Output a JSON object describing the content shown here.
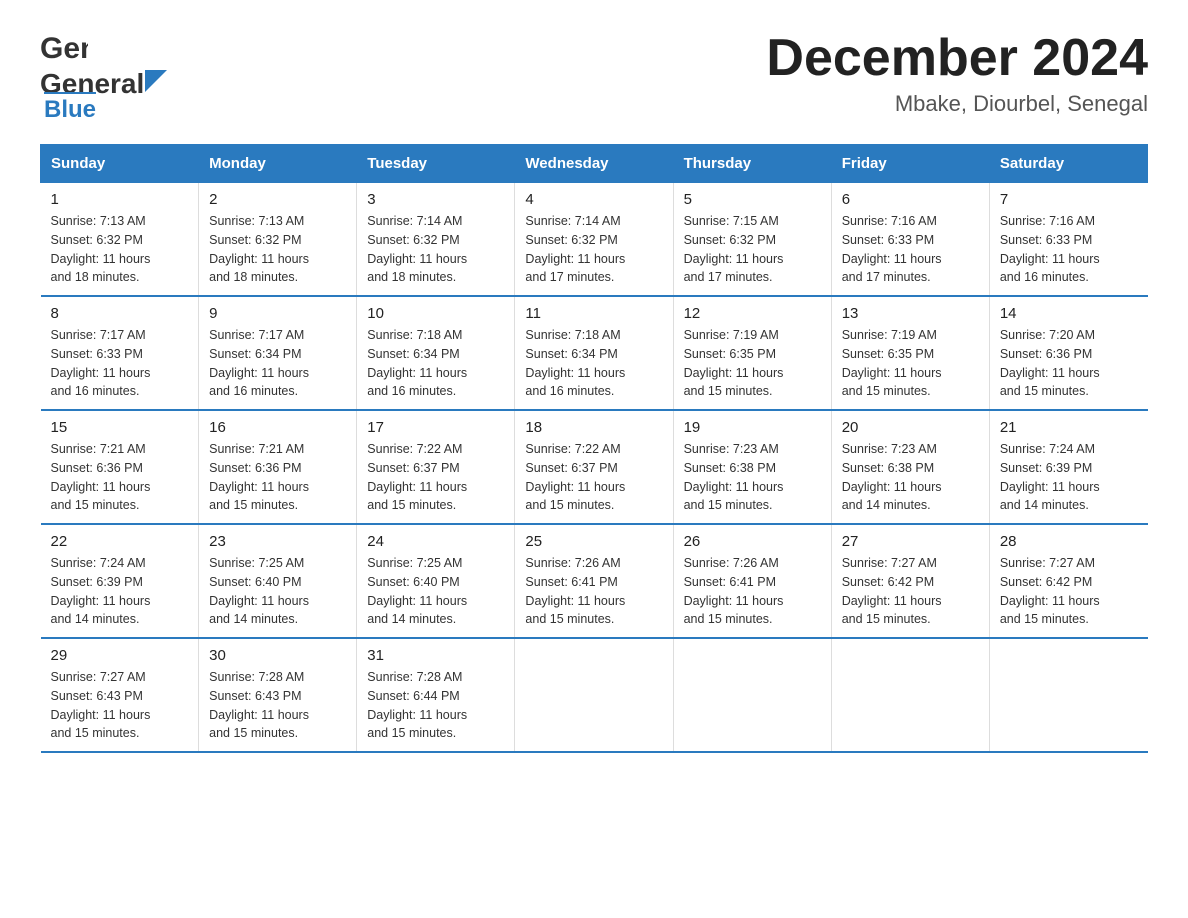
{
  "logo": {
    "general": "General",
    "blue": "Blue"
  },
  "title": {
    "month": "December 2024",
    "location": "Mbake, Diourbel, Senegal"
  },
  "days_of_week": [
    "Sunday",
    "Monday",
    "Tuesday",
    "Wednesday",
    "Thursday",
    "Friday",
    "Saturday"
  ],
  "weeks": [
    [
      {
        "day": 1,
        "sunrise": "7:13 AM",
        "sunset": "6:32 PM",
        "daylight": "11 hours and 18 minutes."
      },
      {
        "day": 2,
        "sunrise": "7:13 AM",
        "sunset": "6:32 PM",
        "daylight": "11 hours and 18 minutes."
      },
      {
        "day": 3,
        "sunrise": "7:14 AM",
        "sunset": "6:32 PM",
        "daylight": "11 hours and 18 minutes."
      },
      {
        "day": 4,
        "sunrise": "7:14 AM",
        "sunset": "6:32 PM",
        "daylight": "11 hours and 17 minutes."
      },
      {
        "day": 5,
        "sunrise": "7:15 AM",
        "sunset": "6:32 PM",
        "daylight": "11 hours and 17 minutes."
      },
      {
        "day": 6,
        "sunrise": "7:16 AM",
        "sunset": "6:33 PM",
        "daylight": "11 hours and 17 minutes."
      },
      {
        "day": 7,
        "sunrise": "7:16 AM",
        "sunset": "6:33 PM",
        "daylight": "11 hours and 16 minutes."
      }
    ],
    [
      {
        "day": 8,
        "sunrise": "7:17 AM",
        "sunset": "6:33 PM",
        "daylight": "11 hours and 16 minutes."
      },
      {
        "day": 9,
        "sunrise": "7:17 AM",
        "sunset": "6:34 PM",
        "daylight": "11 hours and 16 minutes."
      },
      {
        "day": 10,
        "sunrise": "7:18 AM",
        "sunset": "6:34 PM",
        "daylight": "11 hours and 16 minutes."
      },
      {
        "day": 11,
        "sunrise": "7:18 AM",
        "sunset": "6:34 PM",
        "daylight": "11 hours and 16 minutes."
      },
      {
        "day": 12,
        "sunrise": "7:19 AM",
        "sunset": "6:35 PM",
        "daylight": "11 hours and 15 minutes."
      },
      {
        "day": 13,
        "sunrise": "7:19 AM",
        "sunset": "6:35 PM",
        "daylight": "11 hours and 15 minutes."
      },
      {
        "day": 14,
        "sunrise": "7:20 AM",
        "sunset": "6:36 PM",
        "daylight": "11 hours and 15 minutes."
      }
    ],
    [
      {
        "day": 15,
        "sunrise": "7:21 AM",
        "sunset": "6:36 PM",
        "daylight": "11 hours and 15 minutes."
      },
      {
        "day": 16,
        "sunrise": "7:21 AM",
        "sunset": "6:36 PM",
        "daylight": "11 hours and 15 minutes."
      },
      {
        "day": 17,
        "sunrise": "7:22 AM",
        "sunset": "6:37 PM",
        "daylight": "11 hours and 15 minutes."
      },
      {
        "day": 18,
        "sunrise": "7:22 AM",
        "sunset": "6:37 PM",
        "daylight": "11 hours and 15 minutes."
      },
      {
        "day": 19,
        "sunrise": "7:23 AM",
        "sunset": "6:38 PM",
        "daylight": "11 hours and 15 minutes."
      },
      {
        "day": 20,
        "sunrise": "7:23 AM",
        "sunset": "6:38 PM",
        "daylight": "11 hours and 14 minutes."
      },
      {
        "day": 21,
        "sunrise": "7:24 AM",
        "sunset": "6:39 PM",
        "daylight": "11 hours and 14 minutes."
      }
    ],
    [
      {
        "day": 22,
        "sunrise": "7:24 AM",
        "sunset": "6:39 PM",
        "daylight": "11 hours and 14 minutes."
      },
      {
        "day": 23,
        "sunrise": "7:25 AM",
        "sunset": "6:40 PM",
        "daylight": "11 hours and 14 minutes."
      },
      {
        "day": 24,
        "sunrise": "7:25 AM",
        "sunset": "6:40 PM",
        "daylight": "11 hours and 14 minutes."
      },
      {
        "day": 25,
        "sunrise": "7:26 AM",
        "sunset": "6:41 PM",
        "daylight": "11 hours and 15 minutes."
      },
      {
        "day": 26,
        "sunrise": "7:26 AM",
        "sunset": "6:41 PM",
        "daylight": "11 hours and 15 minutes."
      },
      {
        "day": 27,
        "sunrise": "7:27 AM",
        "sunset": "6:42 PM",
        "daylight": "11 hours and 15 minutes."
      },
      {
        "day": 28,
        "sunrise": "7:27 AM",
        "sunset": "6:42 PM",
        "daylight": "11 hours and 15 minutes."
      }
    ],
    [
      {
        "day": 29,
        "sunrise": "7:27 AM",
        "sunset": "6:43 PM",
        "daylight": "11 hours and 15 minutes."
      },
      {
        "day": 30,
        "sunrise": "7:28 AM",
        "sunset": "6:43 PM",
        "daylight": "11 hours and 15 minutes."
      },
      {
        "day": 31,
        "sunrise": "7:28 AM",
        "sunset": "6:44 PM",
        "daylight": "11 hours and 15 minutes."
      },
      null,
      null,
      null,
      null
    ]
  ],
  "labels": {
    "sunrise": "Sunrise:",
    "sunset": "Sunset:",
    "daylight": "Daylight:"
  }
}
